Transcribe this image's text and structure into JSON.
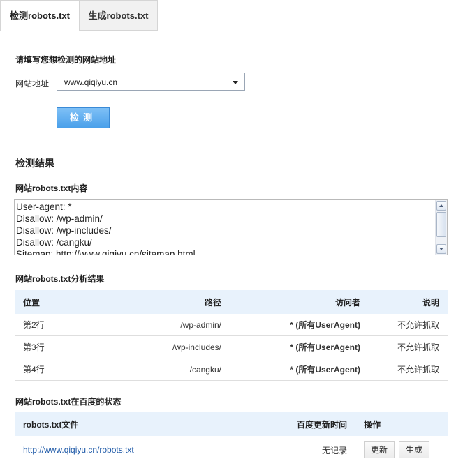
{
  "tabs": [
    {
      "label": "检测robots.txt",
      "active": true
    },
    {
      "label": "生成robots.txt",
      "active": false
    }
  ],
  "form": {
    "heading": "请填写您想检测的网站地址",
    "site_label": "网站地址",
    "site_value": "www.qiqiyu.cn",
    "check_button": "检测"
  },
  "results": {
    "heading": "检测结果",
    "content_heading": "网站robots.txt内容",
    "content_lines": [
      "User-agent: *",
      "Disallow: /wp-admin/",
      "Disallow: /wp-includes/",
      "Disallow: /cangku/",
      "Sitemap: http://www.qiqiyu.cn/sitemap.html"
    ],
    "analysis_heading": "网站robots.txt分析结果",
    "analysis_columns": [
      "位置",
      "路径",
      "访问者",
      "说明"
    ],
    "analysis_rows": [
      {
        "position": "第2行",
        "path": "/wp-admin/",
        "visitor": "* (所有UserAgent)",
        "note": "不允许抓取"
      },
      {
        "position": "第3行",
        "path": "/wp-includes/",
        "visitor": "* (所有UserAgent)",
        "note": "不允许抓取"
      },
      {
        "position": "第4行",
        "path": "/cangku/",
        "visitor": "* (所有UserAgent)",
        "note": "不允许抓取"
      }
    ],
    "baidu_heading": "网站robots.txt在百度的状态",
    "baidu_columns": [
      "robots.txt文件",
      "百度更新时间",
      "操作"
    ],
    "baidu_row": {
      "file_url": "http://www.qiqiyu.cn/robots.txt",
      "update_time": "无记录",
      "update_button": "更新",
      "generate_button": "生成"
    }
  },
  "colors": {
    "accent": "#4aa0ea",
    "header_bg": "#e8f2fc",
    "link": "#1f5aa8"
  }
}
